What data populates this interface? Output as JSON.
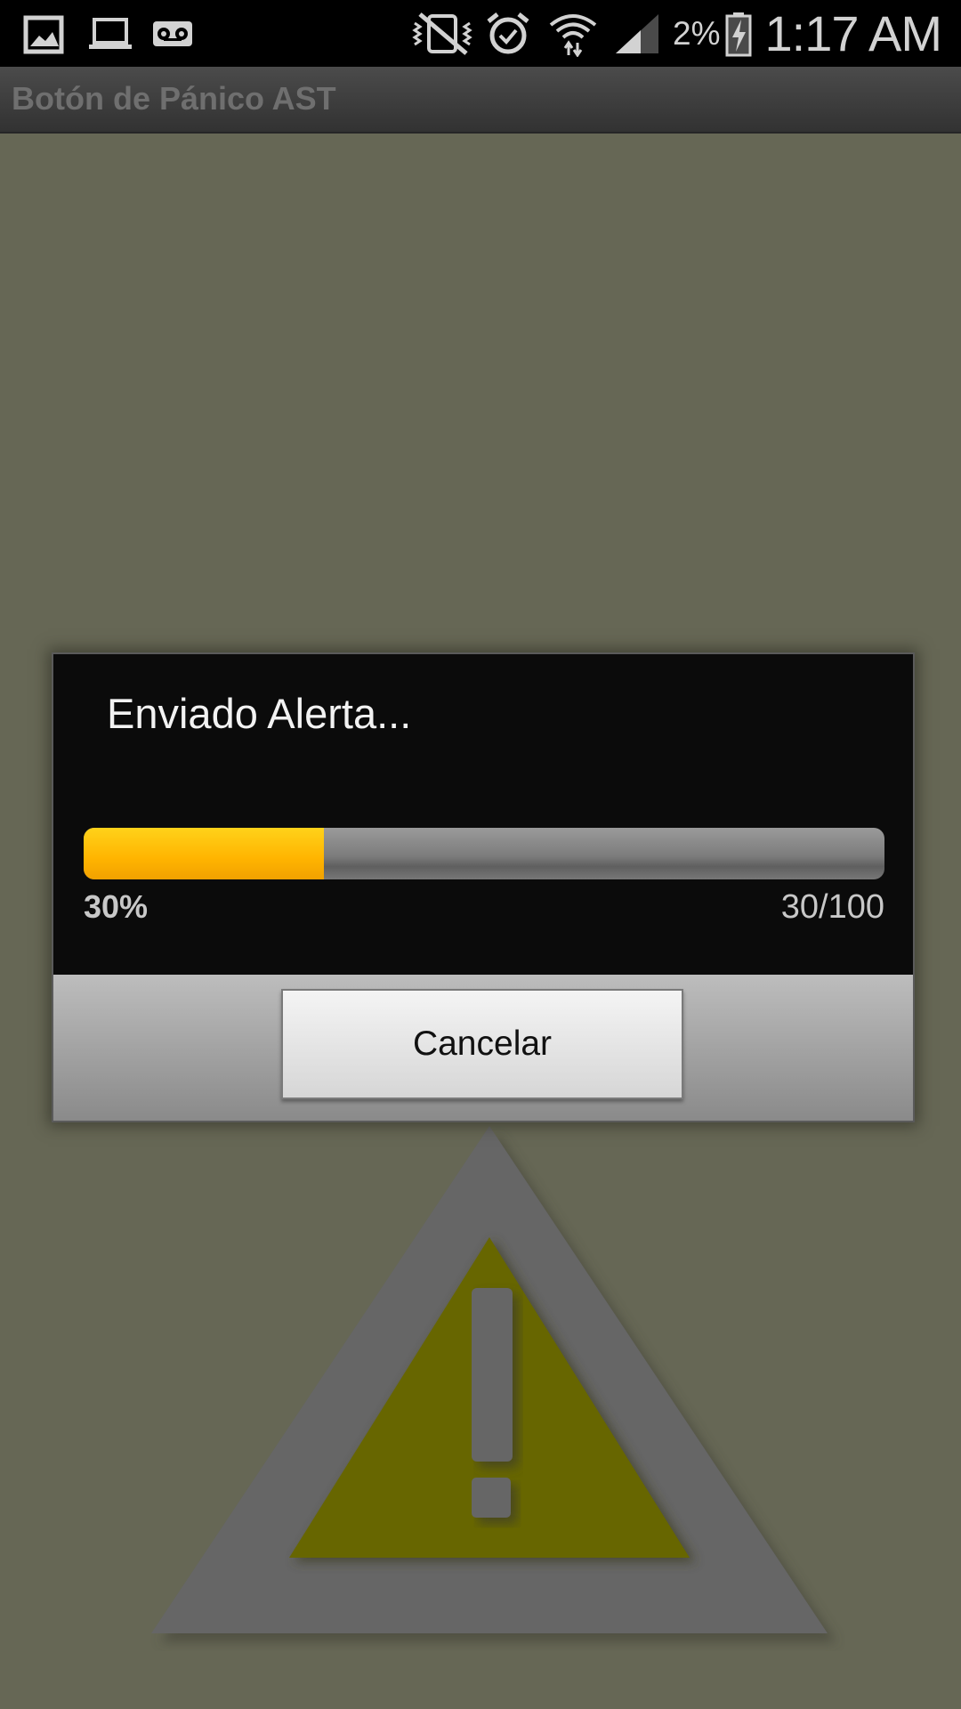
{
  "status_bar": {
    "icons_left": [
      "gallery-icon",
      "laptop-icon",
      "voicemail-icon"
    ],
    "icons_right": [
      "vibrate-icon",
      "alarm-icon",
      "wifi-icon",
      "signal-icon",
      "battery-charging-icon"
    ],
    "battery_text": "2%",
    "time": "1:17 AM"
  },
  "action_bar": {
    "title": "Botón de Pánico AST"
  },
  "dialog": {
    "title": "Enviado Alerta...",
    "progress": {
      "value": 30,
      "max": 100,
      "percent_label": "30%",
      "count_label": "30/100"
    },
    "cancel_label": "Cancelar"
  },
  "background": {
    "icon": "warning-icon"
  },
  "colors": {
    "background": "#666755",
    "progress_fill": "#ffb400",
    "warning_fill": "#676600",
    "warning_border": "#666666"
  }
}
